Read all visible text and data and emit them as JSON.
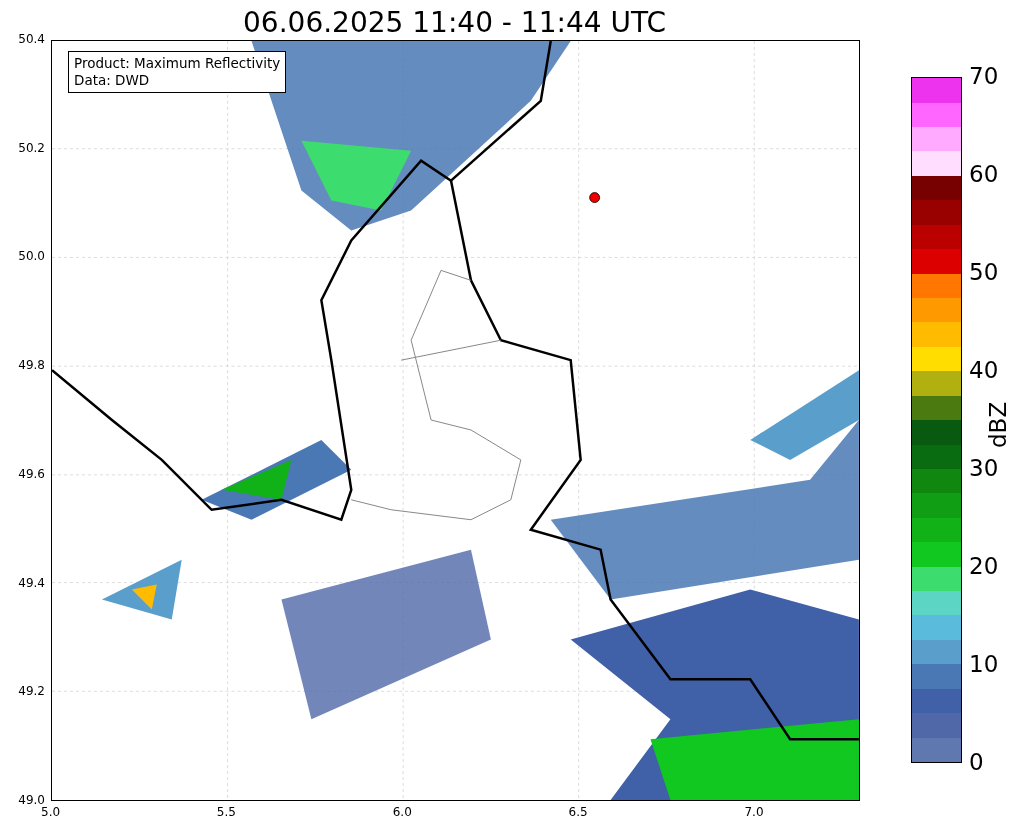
{
  "title": "06.06.2025 11:40 - 11:44 UTC",
  "legend": {
    "lines": [
      "Product: Maximum Reflectivity",
      "Data: DWD"
    ]
  },
  "x_axis": {
    "ticks": [
      "5.0",
      "5.5",
      "6.0",
      "6.5",
      "7.0"
    ]
  },
  "y_axis": {
    "ticks": [
      "50.4",
      "50.2",
      "50.0",
      "49.8",
      "49.6",
      "49.4",
      "49.2",
      "49.0"
    ]
  },
  "colorbar": {
    "label": "dBZ",
    "ticks": [
      "70",
      "60",
      "50",
      "40",
      "30",
      "20",
      "10",
      "0"
    ],
    "segments": [
      {
        "color": "#6078b0"
      },
      {
        "color": "#5068a8"
      },
      {
        "color": "#4060a8"
      },
      {
        "color": "#4a78b4"
      },
      {
        "color": "#5a9ecb"
      },
      {
        "color": "#5bbbdd"
      },
      {
        "color": "#5dd5c5"
      },
      {
        "color": "#3ddc6e"
      },
      {
        "color": "#10c820"
      },
      {
        "color": "#10b218"
      },
      {
        "color": "#109e14"
      },
      {
        "color": "#108810"
      },
      {
        "color": "#0a6c10"
      },
      {
        "color": "#075a10"
      },
      {
        "color": "#4a7a10"
      },
      {
        "color": "#b0b010"
      },
      {
        "color": "#ffdd00"
      },
      {
        "color": "#ffbb00"
      },
      {
        "color": "#ff9900"
      },
      {
        "color": "#ff7700"
      },
      {
        "color": "#dd0000"
      },
      {
        "color": "#bb0000"
      },
      {
        "color": "#990000"
      },
      {
        "color": "#770000"
      },
      {
        "color": "#ffddff"
      },
      {
        "color": "#ffaaff"
      },
      {
        "color": "#ff66ff"
      },
      {
        "color": "#ee33ee"
      }
    ]
  }
}
